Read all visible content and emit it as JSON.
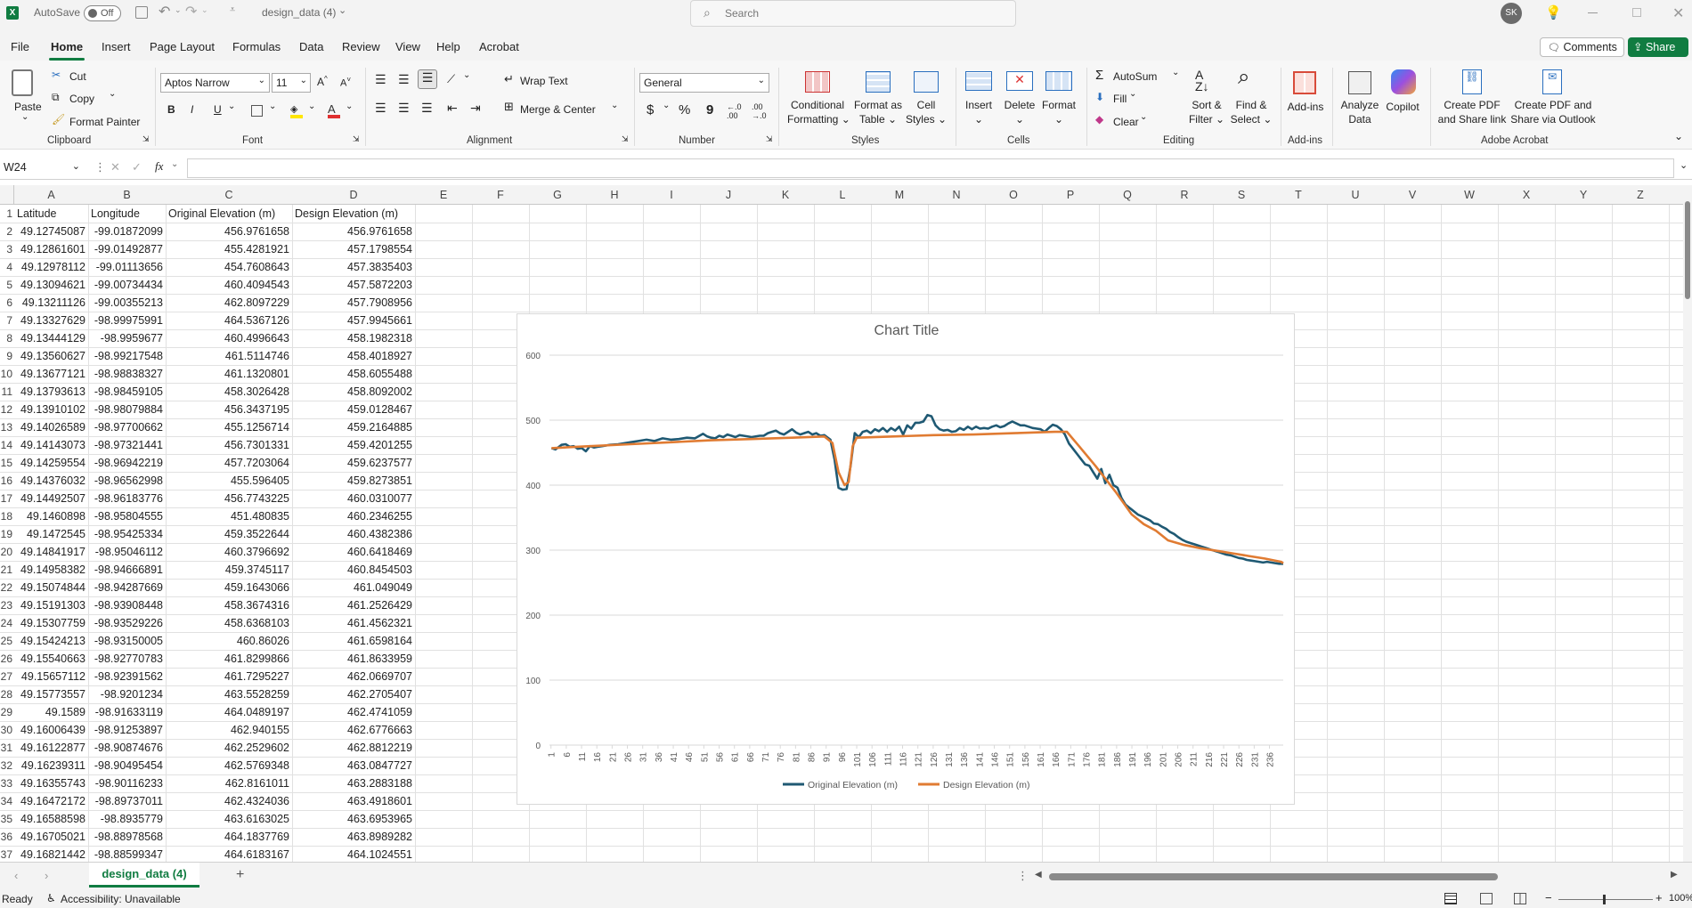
{
  "titlebar": {
    "app_icon": "excel-icon",
    "autosave_label": "AutoSave",
    "autosave_state": "Off",
    "file_name": "design_data (4)",
    "search_placeholder": "Search",
    "user_initials": "SK"
  },
  "menu": {
    "tabs": [
      "File",
      "Home",
      "Insert",
      "Page Layout",
      "Formulas",
      "Data",
      "Review",
      "View",
      "Help",
      "Acrobat"
    ],
    "active_tab": "Home",
    "comments_label": "Comments",
    "share_label": "Share"
  },
  "ribbon": {
    "clipboard": {
      "paste": "Paste",
      "cut": "Cut",
      "copy": "Copy",
      "format_painter": "Format Painter",
      "label": "Clipboard"
    },
    "font": {
      "name": "Aptos Narrow",
      "size": "11",
      "label": "Font",
      "bold": "B",
      "italic": "I",
      "underline": "U"
    },
    "alignment": {
      "wrap_text": "Wrap Text",
      "merge_center": "Merge & Center",
      "label": "Alignment"
    },
    "number": {
      "format": "General",
      "label": "Number",
      "currency": "$",
      "percent": "%",
      "comma": "9"
    },
    "styles": {
      "conditional_1": "Conditional",
      "conditional_2": "Formatting",
      "format_table_1": "Format as",
      "format_table_2": "Table",
      "cell_styles_1": "Cell",
      "cell_styles_2": "Styles",
      "label": "Styles"
    },
    "cells": {
      "insert": "Insert",
      "delete": "Delete",
      "format": "Format",
      "label": "Cells"
    },
    "editing": {
      "autosum": "AutoSum",
      "fill": "Fill",
      "clear": "Clear",
      "sort_1": "Sort &",
      "sort_2": "Filter",
      "find_1": "Find &",
      "find_2": "Select",
      "label": "Editing"
    },
    "addins": {
      "addins": "Add-ins",
      "analyze_1": "Analyze",
      "analyze_2": "Data",
      "copilot": "Copilot",
      "label": "Add-ins"
    },
    "acrobat": {
      "pdf_link_1": "Create PDF",
      "pdf_link_2": "and Share link",
      "pdf_outlook_1": "Create PDF and",
      "pdf_outlook_2": "Share via Outlook",
      "label": "Adobe Acrobat"
    }
  },
  "formula_bar": {
    "name_box": "W24",
    "fx": "fx",
    "formula": ""
  },
  "columns": [
    "A",
    "B",
    "C",
    "D",
    "E",
    "F",
    "G",
    "H",
    "I",
    "J",
    "K",
    "L",
    "M",
    "N",
    "O",
    "P",
    "Q",
    "R",
    "S",
    "T",
    "U",
    "V",
    "W",
    "X",
    "Y",
    "Z"
  ],
  "table": {
    "headers": [
      "Latitude",
      "Longitude",
      "Original Elevation (m)",
      "Design Elevation (m)"
    ],
    "rows": [
      [
        "49.12745087",
        "-99.01872099",
        "456.9761658",
        "456.9761658"
      ],
      [
        "49.12861601",
        "-99.01492877",
        "455.4281921",
        "457.1798554"
      ],
      [
        "49.12978112",
        "-99.01113656",
        "454.7608643",
        "457.3835403"
      ],
      [
        "49.13094621",
        "-99.00734434",
        "460.4094543",
        "457.5872203"
      ],
      [
        "49.13211126",
        "-99.00355213",
        "462.8097229",
        "457.7908956"
      ],
      [
        "49.13327629",
        "-98.99975991",
        "464.5367126",
        "457.9945661"
      ],
      [
        "49.13444129",
        "-98.9959677",
        "460.4996643",
        "458.1982318"
      ],
      [
        "49.13560627",
        "-98.99217548",
        "461.5114746",
        "458.4018927"
      ],
      [
        "49.13677121",
        "-98.98838327",
        "461.1320801",
        "458.6055488"
      ],
      [
        "49.13793613",
        "-98.98459105",
        "458.3026428",
        "458.8092002"
      ],
      [
        "49.13910102",
        "-98.98079884",
        "456.3437195",
        "459.0128467"
      ],
      [
        "49.14026589",
        "-98.97700662",
        "455.1256714",
        "459.2164885"
      ],
      [
        "49.14143073",
        "-98.97321441",
        "456.7301331",
        "459.4201255"
      ],
      [
        "49.14259554",
        "-98.96942219",
        "457.7203064",
        "459.6237577"
      ],
      [
        "49.14376032",
        "-98.96562998",
        "455.596405",
        "459.8273851"
      ],
      [
        "49.14492507",
        "-98.96183776",
        "456.7743225",
        "460.0310077"
      ],
      [
        "49.1460898",
        "-98.95804555",
        "451.480835",
        "460.2346255"
      ],
      [
        "49.1472545",
        "-98.95425334",
        "459.3522644",
        "460.4382386"
      ],
      [
        "49.14841917",
        "-98.95046112",
        "460.3796692",
        "460.6418469"
      ],
      [
        "49.14958382",
        "-98.94666891",
        "459.3745117",
        "460.8454503"
      ],
      [
        "49.15074844",
        "-98.94287669",
        "459.1643066",
        "461.049049"
      ],
      [
        "49.15191303",
        "-98.93908448",
        "458.3674316",
        "461.2526429"
      ],
      [
        "49.15307759",
        "-98.93529226",
        "458.6368103",
        "461.4562321"
      ],
      [
        "49.15424213",
        "-98.93150005",
        "460.86026",
        "461.6598164"
      ],
      [
        "49.15540663",
        "-98.92770783",
        "461.8299866",
        "461.8633959"
      ],
      [
        "49.15657112",
        "-98.92391562",
        "461.7295227",
        "462.0669707"
      ],
      [
        "49.15773557",
        "-98.9201234",
        "463.5528259",
        "462.2705407"
      ],
      [
        "49.1589",
        "-98.91633119",
        "464.0489197",
        "462.4741059"
      ],
      [
        "49.16006439",
        "-98.91253897",
        "462.940155",
        "462.6776663"
      ],
      [
        "49.16122877",
        "-98.90874676",
        "462.2529602",
        "462.8812219"
      ],
      [
        "49.16239311",
        "-98.90495454",
        "462.5769348",
        "463.0847727"
      ],
      [
        "49.16355743",
        "-98.90116233",
        "462.8161011",
        "463.2883188"
      ],
      [
        "49.16472172",
        "-98.89737011",
        "462.4324036",
        "463.4918601"
      ],
      [
        "49.16588598",
        "-98.8935779",
        "463.6163025",
        "463.6953965"
      ],
      [
        "49.16705021",
        "-98.88978568",
        "464.1837769",
        "463.8989282"
      ],
      [
        "49.16821442",
        "-98.88599347",
        "464.6183167",
        "464.1024551"
      ]
    ]
  },
  "chart_data": {
    "type": "line",
    "title": "Chart Title",
    "xlabel": "",
    "ylabel": "",
    "ylim": [
      0,
      600
    ],
    "yticks": [
      0,
      100,
      200,
      300,
      400,
      500,
      600
    ],
    "xticks": [
      1,
      6,
      11,
      16,
      21,
      26,
      31,
      36,
      41,
      46,
      51,
      56,
      61,
      66,
      71,
      76,
      81,
      86,
      91,
      96,
      101,
      106,
      111,
      116,
      121,
      126,
      131,
      136,
      141,
      146,
      151,
      156,
      161,
      166,
      171,
      176,
      181,
      186,
      191,
      196,
      201,
      206,
      211,
      216,
      221,
      226,
      231,
      236
    ],
    "x_count": 240,
    "legend_position": "bottom",
    "grid": true,
    "series": [
      {
        "name": "Original Elevation (m)",
        "color": "#1f5973",
        "points": [
          [
            1,
            457
          ],
          [
            3,
            455
          ],
          [
            6,
            462
          ],
          [
            8,
            463
          ],
          [
            10,
            459
          ],
          [
            12,
            460
          ],
          [
            14,
            456
          ],
          [
            16,
            457
          ],
          [
            18,
            452
          ],
          [
            20,
            460
          ],
          [
            22,
            458
          ],
          [
            24,
            459
          ],
          [
            26,
            460
          ],
          [
            30,
            462
          ],
          [
            34,
            463
          ],
          [
            40,
            466
          ],
          [
            44,
            468
          ],
          [
            48,
            470
          ],
          [
            52,
            468
          ],
          [
            56,
            472
          ],
          [
            60,
            470
          ],
          [
            64,
            471
          ],
          [
            68,
            473
          ],
          [
            72,
            472
          ],
          [
            76,
            479
          ],
          [
            78,
            475
          ],
          [
            80,
            473
          ],
          [
            82,
            472
          ],
          [
            84,
            476
          ],
          [
            86,
            474
          ],
          [
            88,
            478
          ],
          [
            90,
            476
          ],
          [
            92,
            474
          ],
          [
            94,
            477
          ],
          [
            96,
            476
          ],
          [
            100,
            474
          ],
          [
            104,
            476
          ],
          [
            106,
            476
          ],
          [
            108,
            480
          ],
          [
            110,
            482
          ],
          [
            112,
            484
          ],
          [
            114,
            480
          ],
          [
            116,
            478
          ],
          [
            120,
            486
          ],
          [
            122,
            481
          ],
          [
            124,
            478
          ],
          [
            126,
            480
          ],
          [
            128,
            482
          ],
          [
            130,
            478
          ],
          [
            132,
            480
          ],
          [
            134,
            476
          ],
          [
            136,
            477
          ],
          [
            139,
            470
          ],
          [
            141,
            440
          ],
          [
            143,
            396
          ],
          [
            145,
            393
          ],
          [
            147,
            394
          ],
          [
            149,
            430
          ],
          [
            151,
            480
          ],
          [
            153,
            474
          ],
          [
            155,
            482
          ],
          [
            157,
            484
          ],
          [
            159,
            480
          ],
          [
            161,
            486
          ],
          [
            163,
            483
          ],
          [
            165,
            488
          ],
          [
            167,
            482
          ],
          [
            169,
            488
          ],
          [
            171,
            484
          ],
          [
            173,
            490
          ],
          [
            175,
            478
          ],
          [
            177,
            492
          ],
          [
            179,
            487
          ],
          [
            181,
            496
          ],
          [
            183,
            496
          ],
          [
            185,
            498
          ],
          [
            187,
            508
          ],
          [
            189,
            506
          ],
          [
            191,
            492
          ],
          [
            193,
            486
          ],
          [
            195,
            484
          ],
          [
            197,
            485
          ],
          [
            199,
            482
          ],
          [
            201,
            483
          ],
          [
            203,
            488
          ],
          [
            205,
            485
          ],
          [
            207,
            490
          ],
          [
            209,
            486
          ],
          [
            211,
            490
          ],
          [
            213,
            487
          ],
          [
            215,
            488
          ],
          [
            217,
            487
          ],
          [
            219,
            490
          ],
          [
            221,
            492
          ],
          [
            223,
            489
          ],
          [
            225,
            491
          ],
          [
            227,
            495
          ],
          [
            229,
            498
          ],
          [
            231,
            495
          ],
          [
            233,
            492
          ],
          [
            235,
            492
          ],
          [
            237,
            490
          ],
          [
            239,
            488
          ],
          [
            241,
            487
          ],
          [
            243,
            486
          ],
          [
            245,
            482
          ],
          [
            247,
            488
          ],
          [
            249,
            493
          ],
          [
            251,
            491
          ],
          [
            253,
            486
          ],
          [
            255,
            478
          ],
          [
            257,
            464
          ],
          [
            259,
            456
          ],
          [
            261,
            448
          ],
          [
            263,
            440
          ],
          [
            265,
            432
          ],
          [
            267,
            430
          ],
          [
            269,
            420
          ],
          [
            271,
            410
          ],
          [
            273,
            425
          ],
          [
            275,
            403
          ],
          [
            277,
            416
          ],
          [
            279,
            400
          ],
          [
            281,
            396
          ],
          [
            283,
            380
          ],
          [
            285,
            370
          ],
          [
            287,
            365
          ],
          [
            289,
            360
          ],
          [
            291,
            355
          ],
          [
            293,
            352
          ],
          [
            295,
            349
          ],
          [
            297,
            346
          ],
          [
            299,
            341
          ],
          [
            301,
            340
          ],
          [
            303,
            336
          ],
          [
            305,
            333
          ],
          [
            307,
            328
          ],
          [
            309,
            325
          ],
          [
            311,
            320
          ],
          [
            313,
            316
          ],
          [
            315,
            313
          ],
          [
            317,
            311
          ],
          [
            319,
            309
          ],
          [
            321,
            307
          ],
          [
            323,
            305
          ],
          [
            325,
            303
          ],
          [
            327,
            301
          ],
          [
            329,
            299
          ],
          [
            331,
            297
          ],
          [
            333,
            295
          ],
          [
            335,
            293
          ],
          [
            337,
            292
          ],
          [
            339,
            290
          ],
          [
            341,
            288
          ],
          [
            343,
            287
          ],
          [
            345,
            285
          ],
          [
            347,
            284
          ],
          [
            349,
            283
          ],
          [
            351,
            282
          ],
          [
            353,
            281
          ],
          [
            355,
            282
          ],
          [
            357,
            281
          ],
          [
            359,
            280
          ],
          [
            361,
            279
          ],
          [
            363,
            279
          ]
        ]
      },
      {
        "name": "Design Elevation (m)",
        "color": "#e07b32",
        "points": [
          [
            1,
            457
          ],
          [
            20,
            460
          ],
          [
            40,
            463
          ],
          [
            60,
            466
          ],
          [
            80,
            469
          ],
          [
            100,
            471
          ],
          [
            120,
            473
          ],
          [
            136,
            475
          ],
          [
            140,
            465
          ],
          [
            143,
            420
          ],
          [
            146,
            400
          ],
          [
            148,
            405
          ],
          [
            150,
            460
          ],
          [
            152,
            473
          ],
          [
            170,
            475
          ],
          [
            190,
            477
          ],
          [
            210,
            478
          ],
          [
            230,
            480
          ],
          [
            250,
            482
          ],
          [
            256,
            482
          ],
          [
            262,
            460
          ],
          [
            270,
            430
          ],
          [
            280,
            390
          ],
          [
            288,
            355
          ],
          [
            294,
            340
          ],
          [
            300,
            330
          ],
          [
            306,
            315
          ],
          [
            314,
            308
          ],
          [
            322,
            303
          ],
          [
            330,
            299
          ],
          [
            338,
            295
          ],
          [
            346,
            291
          ],
          [
            354,
            287
          ],
          [
            362,
            282
          ],
          [
            363,
            280
          ]
        ]
      }
    ]
  },
  "sheet_tabs": {
    "active": "design_data (4)",
    "add": "+"
  },
  "status": {
    "ready": "Ready",
    "accessibility": "Accessibility: Unavailable",
    "zoom": "100%"
  }
}
